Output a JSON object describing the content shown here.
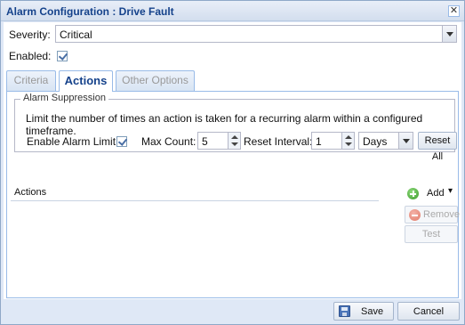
{
  "window": {
    "title": "Alarm Configuration : Drive Fault"
  },
  "form": {
    "severity_label": "Severity:",
    "severity_value": "Critical",
    "enabled_label": "Enabled:"
  },
  "tabs": [
    {
      "label": "Criteria",
      "active": false
    },
    {
      "label": "Actions",
      "active": true
    },
    {
      "label": "Other Options",
      "active": false
    }
  ],
  "suppression": {
    "legend": "Alarm Suppression",
    "description": "Limit the number of times an action is taken for a recurring alarm within a configured timeframe.",
    "enable_label": "Enable Alarm Limit:",
    "max_count_label": "Max Count:",
    "max_count_value": "5",
    "reset_interval_label": "Reset Interval:",
    "reset_interval_value": "1",
    "interval_unit": "Days",
    "reset_all_label": "Reset All"
  },
  "actions": {
    "header": "Actions",
    "add_label": "Add",
    "remove_label": "Remove",
    "test_label": "Test"
  },
  "footer": {
    "save_label": "Save",
    "cancel_label": "Cancel"
  }
}
